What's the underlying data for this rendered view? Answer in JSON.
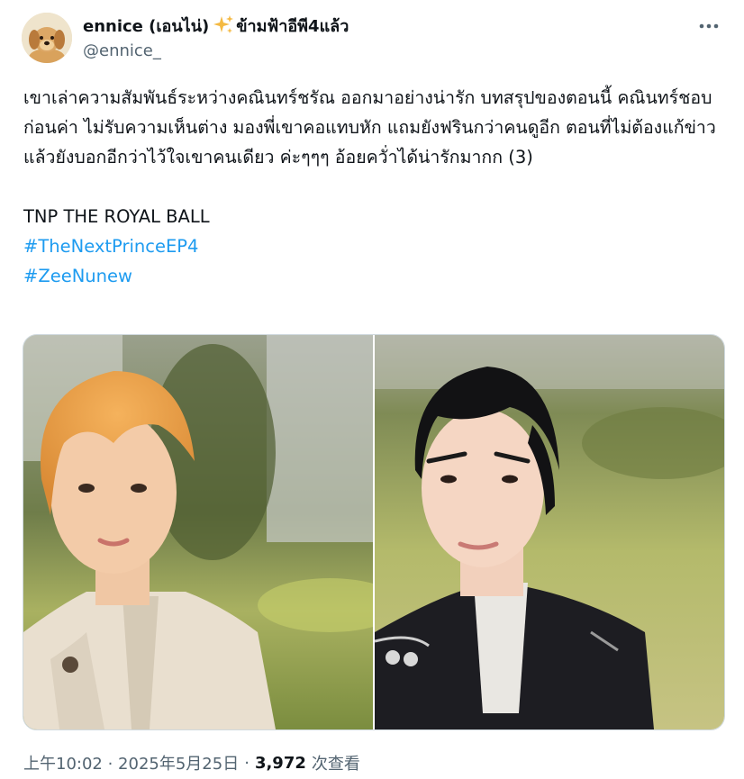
{
  "author": {
    "display_name": "ennice (เอนไน่)",
    "name_suffix": "ข้ามฟ้าอีพี4แล้ว",
    "handle": "@ennice_",
    "avatar_icon": "puppy-avatar",
    "sparkles_icon": "sparkles-icon"
  },
  "more_icon": "more-horizontal-icon",
  "tweet": {
    "paragraph": "เขาเล่าความสัมพันธ์ระหว่างคณินทร์ชรัณ ออกมาอย่างน่ารัก บทสรุปของตอนนี้ คณินทร์ชอบก่อนค่า ไม่รับความเห็นต่าง มองพี่เขาคอแทบหัก แถมยังฟรินกว่าคนดูอีก ตอนที่ไม่ต้องแก้ข่าว แล้วยังบอกอีกว่าไว้ใจเขาคนเดียว ค่ะๆๆๆ อ้อยควั่าได้น่ารักมากก (3)",
    "title_line": "TNP THE ROYAL BALL",
    "hashtags": [
      "#TheNextPrinceEP4",
      "#ZeeNunew"
    ]
  },
  "media": [
    {
      "kind": "photo",
      "subject": "young man with orange hair in cream embroidered shirt, garden background"
    },
    {
      "kind": "photo",
      "subject": "young man with dark hair in black military-style jacket, lawn background"
    }
  ],
  "meta": {
    "timestamp": "上午10:02 · 2025年5月25日",
    "separator": "·",
    "view_count": "3,972",
    "views_label": "次查看"
  },
  "colors": {
    "text_primary": "#0f1419",
    "text_secondary": "#536471",
    "link": "#1d9bf0",
    "border": "#cfd9de"
  }
}
